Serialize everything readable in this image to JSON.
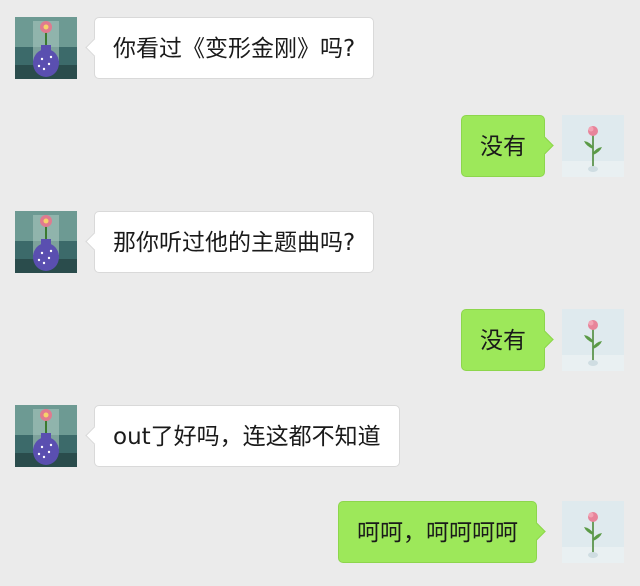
{
  "conversation": {
    "messages": [
      {
        "side": "left",
        "text": "你看过《变形金刚》吗?"
      },
      {
        "side": "right",
        "text": "没有"
      },
      {
        "side": "left",
        "text": "那你听过他的主题曲吗?"
      },
      {
        "side": "right",
        "text": "没有"
      },
      {
        "side": "left",
        "text": "out了好吗，连这都不知道"
      },
      {
        "side": "right",
        "text": "呵呵，呵呵呵呵"
      }
    ]
  },
  "avatars": {
    "contact": "vase-flower-avatar",
    "self": "single-rose-avatar"
  },
  "colors": {
    "background": "#ebebeb",
    "incoming_bubble": "#ffffff",
    "outgoing_bubble": "#9de85a",
    "text": "#1a1a1a"
  }
}
